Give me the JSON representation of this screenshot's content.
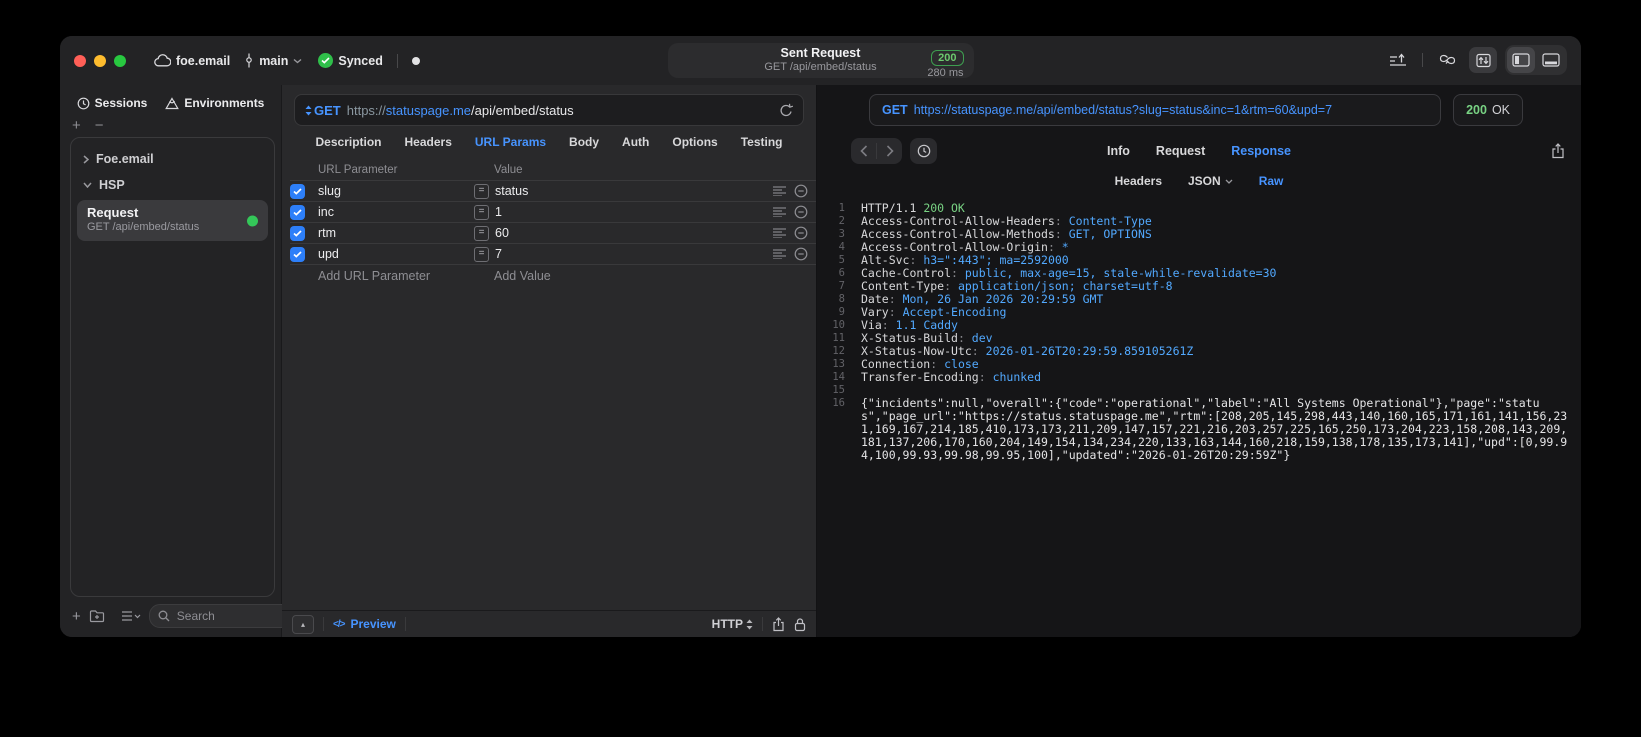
{
  "colors": {
    "accent": "#4794ff",
    "success": "#32d74b",
    "badge_green": "#6cc96e"
  },
  "titlebar": {
    "project": "foe.email",
    "branch": "main",
    "sync_status": "Synced",
    "request_pill": {
      "title": "Sent Request",
      "subtitle": "GET /api/embed/status",
      "status_code": "200",
      "duration": "280 ms"
    }
  },
  "sidebar": {
    "tabs": {
      "sessions": "Sessions",
      "environments": "Environments"
    },
    "add": "+",
    "remove": "−",
    "tree": {
      "group1": "Foe.email",
      "group2": "HSP"
    },
    "request_item": {
      "title": "Request",
      "subtitle": "GET /api/embed/status"
    },
    "search_placeholder": "Search"
  },
  "request_pane": {
    "method": "GET",
    "url": {
      "scheme": "https://",
      "host": "statuspage.me",
      "path": "/api/embed/status"
    },
    "tabs": [
      "Description",
      "Headers",
      "URL Params",
      "Body",
      "Auth",
      "Options",
      "Testing"
    ],
    "params": {
      "columns": {
        "name": "URL Parameter",
        "value": "Value"
      },
      "eq": "=",
      "rows": [
        {
          "name": "slug",
          "value": "status"
        },
        {
          "name": "inc",
          "value": "1"
        },
        {
          "name": "rtm",
          "value": "60"
        },
        {
          "name": "upd",
          "value": "7"
        }
      ],
      "add_row": {
        "name": "Add URL Parameter",
        "value": "Add Value"
      }
    },
    "footer": {
      "expand": "▴",
      "code_icon": "</>",
      "preview": "Preview",
      "protocol": "HTTP"
    }
  },
  "response_pane": {
    "request_line": {
      "method": "GET",
      "url": "https://statuspage.me/api/embed/status?slug=status&inc=1&rtm=60&upd=7"
    },
    "status": {
      "code": "200",
      "text": "OK"
    },
    "tabs": [
      "Info",
      "Request",
      "Response"
    ],
    "subtabs": [
      "Headers",
      "JSON",
      "Raw"
    ],
    "colon": ": ",
    "status_line": {
      "num": "1",
      "protocol": "HTTP/1.1 ",
      "status": "200 OK"
    },
    "headers": [
      {
        "num": "2",
        "key": "Access-Control-Allow-Headers",
        "value": "Content-Type"
      },
      {
        "num": "3",
        "key": "Access-Control-Allow-Methods",
        "value": "GET, OPTIONS"
      },
      {
        "num": "4",
        "key": "Access-Control-Allow-Origin",
        "value": "*"
      },
      {
        "num": "5",
        "key": "Alt-Svc",
        "value": "h3=\":443\"; ma=2592000"
      },
      {
        "num": "6",
        "key": "Cache-Control",
        "value": "public, max-age=15, stale-while-revalidate=30"
      },
      {
        "num": "7",
        "key": "Content-Type",
        "value": "application/json; charset=utf-8"
      },
      {
        "num": "8",
        "key": "Date",
        "value": "Mon, 26 Jan 2026 20:29:59 GMT"
      },
      {
        "num": "9",
        "key": "Vary",
        "value": "Accept-Encoding"
      },
      {
        "num": "10",
        "key": "Via",
        "value": "1.1 Caddy"
      },
      {
        "num": "11",
        "key": "X-Status-Build",
        "value": "dev"
      },
      {
        "num": "12",
        "key": "X-Status-Now-Utc",
        "value": "2026-01-26T20:29:59.859105261Z"
      },
      {
        "num": "13",
        "key": "Connection",
        "value": "close"
      },
      {
        "num": "14",
        "key": "Transfer-Encoding",
        "value": "chunked"
      }
    ],
    "blank_line": {
      "num": "15"
    },
    "body": {
      "num": "16",
      "text": "{\"incidents\":null,\"overall\":{\"code\":\"operational\",\"label\":\"All Systems Operational\"},\"page\":\"status\",\"page_url\":\"https://status.statuspage.me\",\"rtm\":[208,205,145,298,443,140,160,165,171,161,141,156,231,169,167,214,185,410,173,173,211,209,147,157,221,216,203,257,225,165,250,173,204,223,158,208,143,209,181,137,206,170,160,204,149,154,134,234,220,133,163,144,160,218,159,138,178,135,173,141],\"upd\":[0,99.94,100,99.93,99.98,99.95,100],\"updated\":\"2026-01-26T20:29:59Z\"}"
    }
  }
}
